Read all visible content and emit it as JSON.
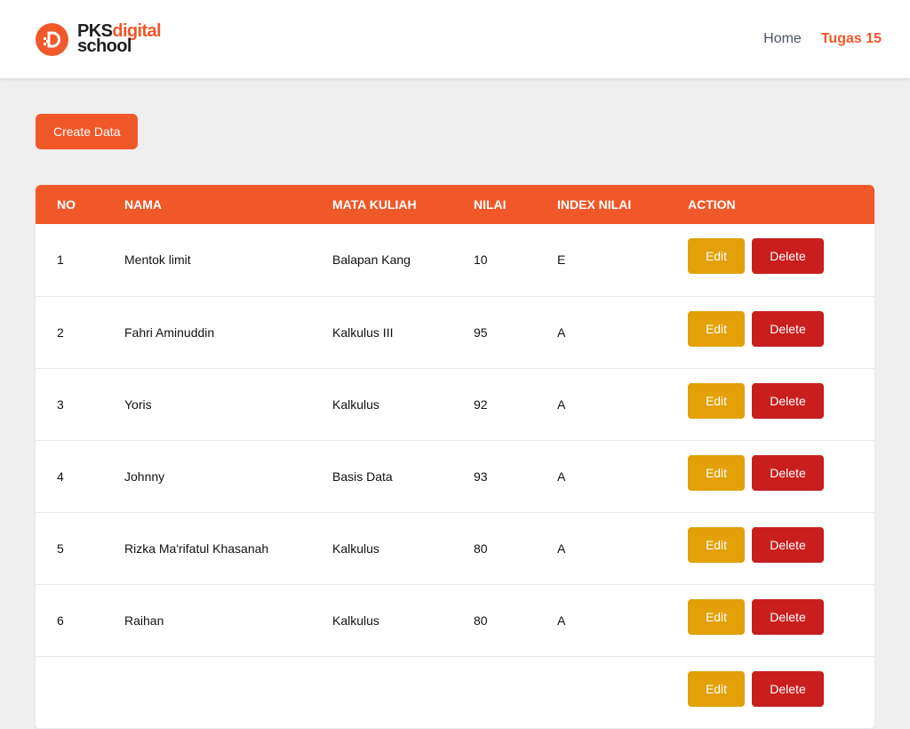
{
  "brand": {
    "name_part1": "PKS",
    "name_part2": "digital",
    "name_part3": "school"
  },
  "nav": {
    "links": [
      {
        "label": "Home",
        "active": false
      },
      {
        "label": "Tugas 15",
        "active": true
      }
    ]
  },
  "create_button": "Create Data",
  "table": {
    "headers": [
      "NO",
      "NAMA",
      "MATA KULIAH",
      "NILAI",
      "INDEX NILAI",
      "ACTION"
    ],
    "edit_label": "Edit",
    "delete_label": "Delete",
    "rows": [
      {
        "no": "1",
        "nama": "Mentok limit",
        "mata_kuliah": "Balapan Kang",
        "nilai": "10",
        "index": "E"
      },
      {
        "no": "2",
        "nama": "Fahri Aminuddin",
        "mata_kuliah": "Kalkulus III",
        "nilai": "95",
        "index": "A"
      },
      {
        "no": "3",
        "nama": "Yoris",
        "mata_kuliah": "Kalkulus",
        "nilai": "92",
        "index": "A"
      },
      {
        "no": "4",
        "nama": "Johnny",
        "mata_kuliah": "Basis Data",
        "nilai": "93",
        "index": "A"
      },
      {
        "no": "5",
        "nama": "Rizka Ma'rifatul Khasanah",
        "mata_kuliah": "Kalkulus",
        "nilai": "80",
        "index": "A"
      },
      {
        "no": "6",
        "nama": "Raihan",
        "mata_kuliah": "Kalkulus",
        "nilai": "80",
        "index": "A"
      },
      {
        "no": "",
        "nama": "",
        "mata_kuliah": "",
        "nilai": "",
        "index": ""
      }
    ]
  },
  "colors": {
    "accent": "#f0582a",
    "edit": "#e3a008",
    "delete": "#c81e1e",
    "background": "#efefef"
  }
}
